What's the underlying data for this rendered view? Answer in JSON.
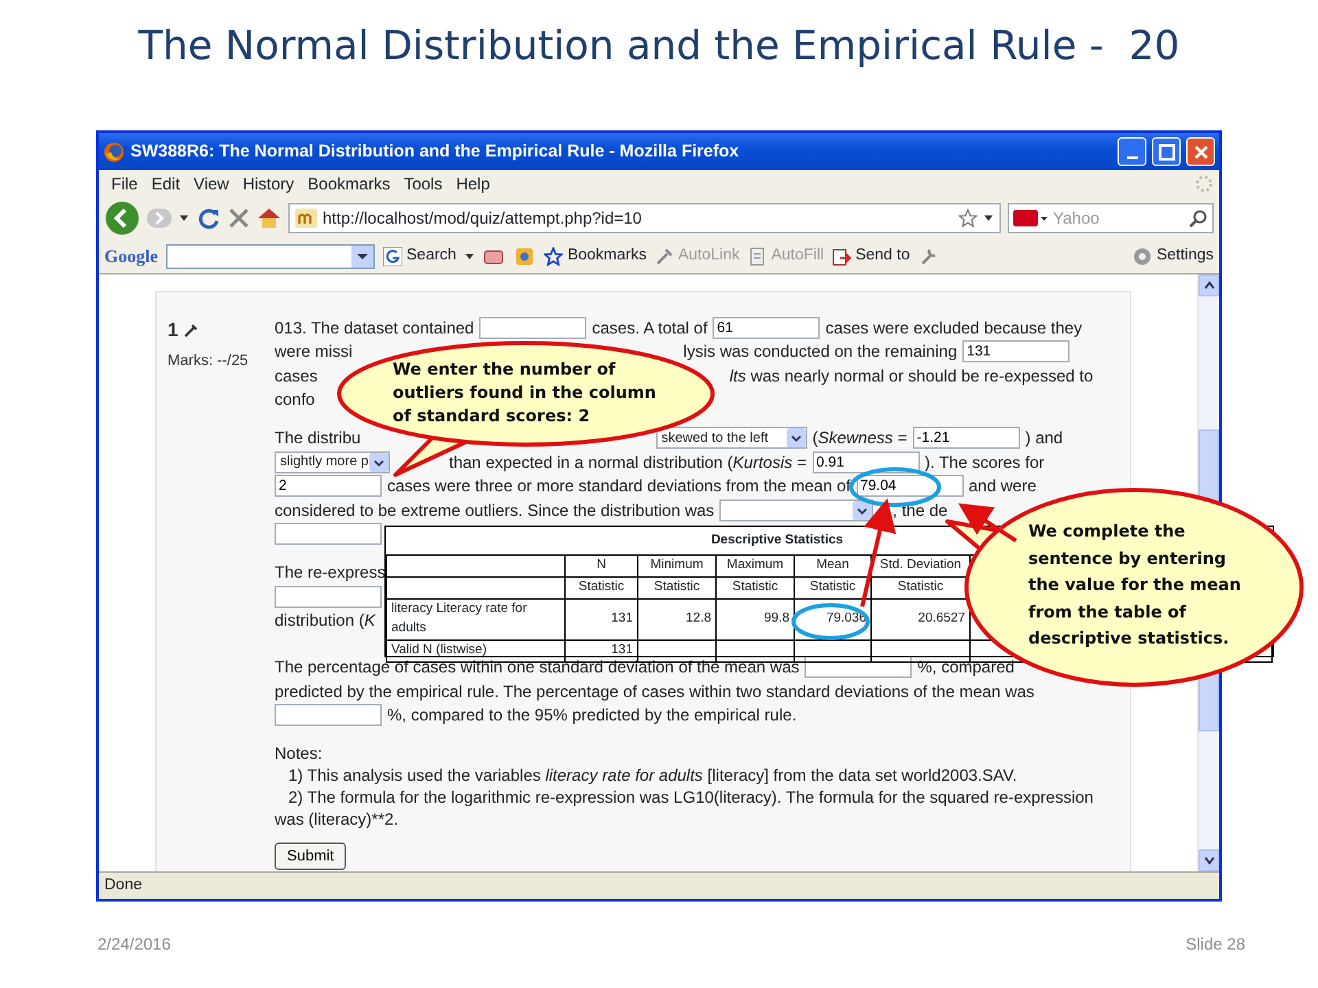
{
  "slide": {
    "title": "The Normal Distribution and the Empirical Rule -  20",
    "date": "2/24/2016",
    "number": "Slide 28"
  },
  "window": {
    "title": "SW388R6: The Normal Distribution and the Empirical Rule - Mozilla Firefox"
  },
  "menu": [
    "File",
    "Edit",
    "View",
    "History",
    "Bookmarks",
    "Tools",
    "Help"
  ],
  "address_bar": {
    "url": "http://localhost/mod/quiz/attempt.php?id=10"
  },
  "search_box": {
    "placeholder": "Yahoo"
  },
  "google_toolbar": {
    "logo": "Google",
    "items": [
      {
        "label": "Search",
        "disabled": false
      },
      {
        "label": "Bookmarks",
        "disabled": false
      },
      {
        "label": "AutoLink",
        "disabled": true
      },
      {
        "label": "AutoFill",
        "disabled": true
      },
      {
        "label": "Send to",
        "disabled": false
      }
    ],
    "settings": "Settings"
  },
  "question": {
    "number": "1",
    "marks": "Marks: --/25",
    "paragraphs": [
      {
        "lines": [
          [
            {
              "kind": "text",
              "text": "013. The dataset contained"
            },
            {
              "kind": "field"
            },
            {
              "kind": "text",
              "text": "cases. A total of"
            },
            {
              "kind": "field",
              "value": "61"
            },
            {
              "kind": "text",
              "text": "cases were excluded because they"
            }
          ],
          [
            {
              "kind": "text",
              "text": "were missi"
            },
            {
              "kind": "text",
              "text": "lysis was conducted on the remaining"
            },
            {
              "kind": "field",
              "value": "131"
            }
          ],
          [
            {
              "kind": "text",
              "text": "cases"
            },
            {
              "kind": "text",
              "text": "*lts* was nearly normal or should be re-expessed to"
            }
          ],
          [
            {
              "kind": "text",
              "text": "confo"
            }
          ]
        ]
      },
      {
        "lines": [
          [
            {
              "kind": "text",
              "text": "The distribu"
            },
            {
              "kind": "select",
              "value": "skewed to the left"
            },
            {
              "kind": "text",
              "text": "(*Skewness* ="
            },
            {
              "kind": "field",
              "value": "-1.21"
            },
            {
              "kind": "text",
              "text": ") and"
            }
          ],
          [
            {
              "kind": "select",
              "value": "slightly more p"
            },
            {
              "kind": "text",
              "text": "than expected in a normal distribution (*Kurtosis* ="
            },
            {
              "kind": "field",
              "value": "0.91"
            },
            {
              "kind": "text",
              "text": "). The scores for"
            }
          ],
          [
            {
              "kind": "field",
              "value": "2"
            },
            {
              "kind": "text",
              "text": "cases were three or more standard deviations from the mean of"
            },
            {
              "kind": "field",
              "value": "79.04"
            },
            {
              "kind": "text",
              "text": "and were"
            }
          ],
          [
            {
              "kind": "text",
              "text": "considered to be extreme outliers. Since the distribution was"
            },
            {
              "kind": "select"
            },
            {
              "kind": "text",
              "text": ", the de"
            }
          ],
          [
            {
              "kind": "field"
            }
          ]
        ]
      },
      {
        "lines": [
          [
            {
              "kind": "text",
              "text": "The re-express"
            }
          ],
          [
            {
              "kind": "field"
            }
          ],
          [
            {
              "kind": "text",
              "text": "distribution (*K*"
            }
          ]
        ]
      },
      {
        "lines": [
          [
            {
              "kind": "text",
              "text": "The percentage of cases within one standard deviation of the mean was"
            },
            {
              "kind": "field"
            },
            {
              "kind": "text",
              "text": "%, compared"
            }
          ],
          [
            {
              "kind": "text",
              "text": "predicted by the empirical rule. The percentage of cases within two standard deviations of the mean was"
            }
          ],
          [
            {
              "kind": "field"
            },
            {
              "kind": "text",
              "text": "%, compared to the 95% predicted by the empirical rule."
            }
          ]
        ]
      }
    ],
    "notes": [
      "Notes:",
      "1) This analysis used the variables *literacy rate for adults* [literacy] from the data set world2003.SAV.",
      "2) The formula for the logarithmic re-expression was LG10(literacy). The formula for the squared re-expression was (literacy)**2."
    ],
    "submit": "Submit"
  },
  "table": {
    "title": "Descriptive Statistics",
    "columns": [
      "N",
      "Minimum",
      "Maximum",
      "Mean",
      "Std. Deviation"
    ],
    "subheader": [
      "Statistic",
      "Statistic",
      "Statistic",
      "Statistic",
      "Statistic"
    ],
    "rows": [
      {
        "label": "literacy Literacy rate for adults",
        "values": [
          "131",
          "12.8",
          "99.8",
          "79.036",
          "20.6527"
        ]
      },
      {
        "label": "Valid N (listwise)",
        "values": [
          "131"
        ]
      }
    ]
  },
  "callouts": [
    {
      "text": "We enter the number of outliers found in the column of standard scores: 2"
    },
    {
      "text": "We complete the sentence by entering the value for the mean from the table of descriptive statistics."
    }
  ],
  "status_bar": "Done"
}
